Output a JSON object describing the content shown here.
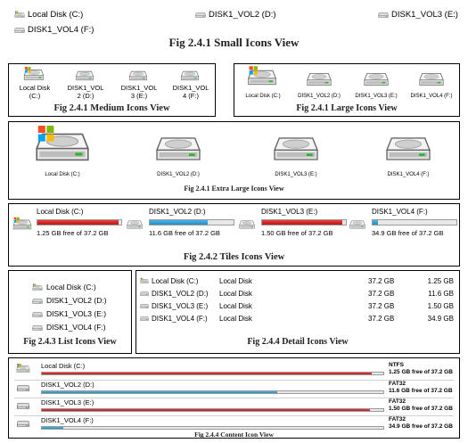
{
  "colors": {
    "low_space": "#c80f0f",
    "normal": "#1e8fc8",
    "border": "#000000"
  },
  "drives": [
    {
      "name": "Local Disk (C:)",
      "short": "Local Disk (C:)",
      "med1": "Local Disk",
      "med2": "(C:)",
      "type": "Local Disk",
      "total": "37.2 GB",
      "free": "1.25 GB",
      "fs": "NTFS",
      "free_text": "1.25 GB free of 37.2 GB",
      "tile_free": "1.25 GB free of 37.2 GB",
      "used_fraction": 0.966,
      "system": true,
      "low": true
    },
    {
      "name": "DISK1_VOL2 (D:)",
      "short": "DISK1_VOL2 (D:)",
      "med1": "DISK1_VOL",
      "med2": "2 (D:)",
      "type": "Local Disk",
      "total": "37.2 GB",
      "free": "11.6 GB",
      "fs": "FAT32",
      "free_text": "11.6 GB free of 37.2 GB",
      "tile_free": "11.6 GB free of 37.2 GB",
      "used_fraction": 0.688,
      "system": false,
      "low": false
    },
    {
      "name": "DISK1_VOL3 (E:)",
      "short": "DISK1_VOL3 (E:)",
      "med1": "DISK1_VOL",
      "med2": "3 (E:)",
      "type": "Local Disk",
      "total": "37.2 GB",
      "free": "1.50 GB",
      "fs": "FAT32",
      "free_text": "1.50 GB free of 37.2 GB",
      "tile_free": "1.50 GB free of 37.2 GB",
      "used_fraction": 0.96,
      "system": false,
      "low": true
    },
    {
      "name": "DISK1_VOL4 (F:)",
      "short": "DISK1_VOL4 (F:)",
      "med1": "DISK1_VOL",
      "med2": "4 (F:)",
      "type": "Local Disk",
      "total": "37.2 GB",
      "free": "34.9 GB",
      "fs": "FAT32",
      "free_text": "34.9 GB free of 37.2 GB",
      "tile_free": "34.9 GB free of 37.2 GB",
      "used_fraction": 0.062,
      "system": false,
      "low": false
    }
  ],
  "captions": {
    "small": "Fig 2.4.1 Small Icons View",
    "medium": "Fig 2.4.1 Medium Icons View",
    "large": "Fig 2.4.1 Large Icons View",
    "xlarge": "Fig 2.4.1 Extra Large Icons View",
    "tiles": "Fig 2.4.2 Tiles Icons View",
    "list": "Fig 2.4.3 List Icons View",
    "detail": "Fig 2.4.4 Detail Icons View",
    "content": "Fig 2.4.4 Content Icon View"
  }
}
